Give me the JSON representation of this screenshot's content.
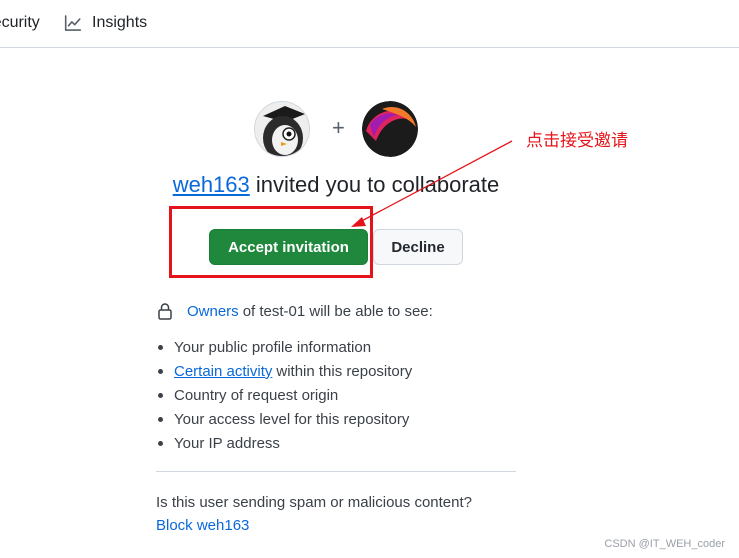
{
  "nav": {
    "security_label": "Security",
    "insights_label": "Insights"
  },
  "invite": {
    "user": "weh163",
    "title_suffix": " invited you to collaborate",
    "plus": "+",
    "accept_label": "Accept invitation",
    "decline_label": "Decline"
  },
  "annotation": {
    "text": "点击接受邀请",
    "color": "#e5141a"
  },
  "permissions": {
    "owners_link": "Owners",
    "owners_suffix": "of test-01 will be able to see:",
    "items": [
      {
        "text": "Your public profile information"
      },
      {
        "link": "Certain activity",
        "text": "within this repository"
      },
      {
        "text": "Country of request origin"
      },
      {
        "text": "Your access level for this repository"
      },
      {
        "text": "Your IP address"
      }
    ]
  },
  "spam": {
    "question": "Is this user sending spam or malicious content?",
    "block_label": "Block weh163"
  },
  "watermark": "CSDN @IT_WEH_coder",
  "colors": {
    "accent_link": "#0969da",
    "accept_green": "#1f883d",
    "annotation_red": "#e5141a"
  }
}
